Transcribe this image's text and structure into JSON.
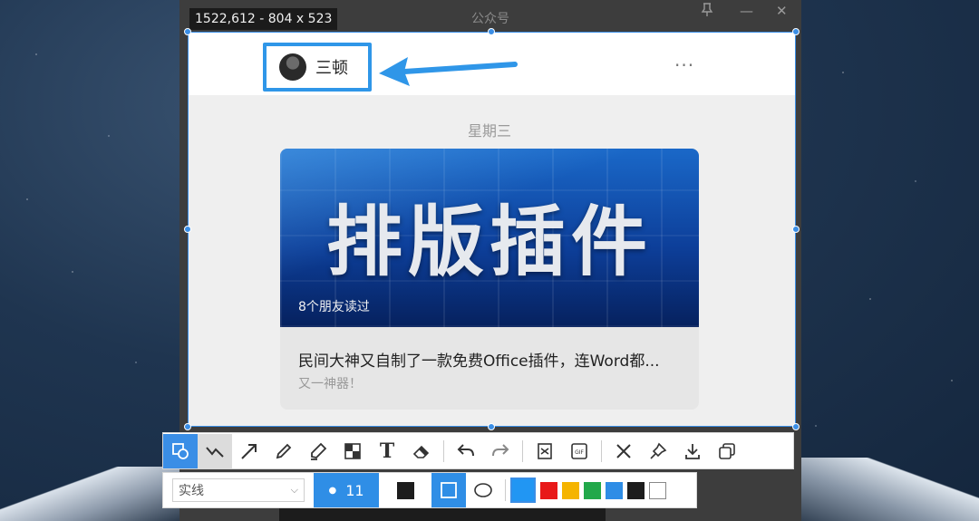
{
  "capture": {
    "dimensions_label": "1522,612 - 804 x 523"
  },
  "window": {
    "title": "公众号"
  },
  "chat": {
    "contact_name": "三顿",
    "more_label": "···",
    "day_label": "星期三",
    "article": {
      "cover_title": "排版插件",
      "readers": "8个朋友读过",
      "headline": "民间大神又自制了一款免费Office插件，连Word都...",
      "subtitle": "又一神器！"
    }
  },
  "toolbar": {
    "tools": [
      "shape-icon",
      "polyline-icon",
      "arrow-icon",
      "pencil-icon",
      "marker-icon",
      "mosaic-icon",
      "text-icon",
      "eraser-icon",
      "undo-icon",
      "redo-icon",
      "ocr-icon",
      "gif-icon",
      "close-icon",
      "pin-icon",
      "download-icon",
      "copy-icon"
    ]
  },
  "options": {
    "line_style": "实线",
    "size_value": "11",
    "colors": [
      "#2196f3",
      "#e81919",
      "#f5b400",
      "#22a84a",
      "#2e8de6",
      "#1d1d1d",
      "#ffffff"
    ]
  },
  "accent": "#3a8ee6"
}
